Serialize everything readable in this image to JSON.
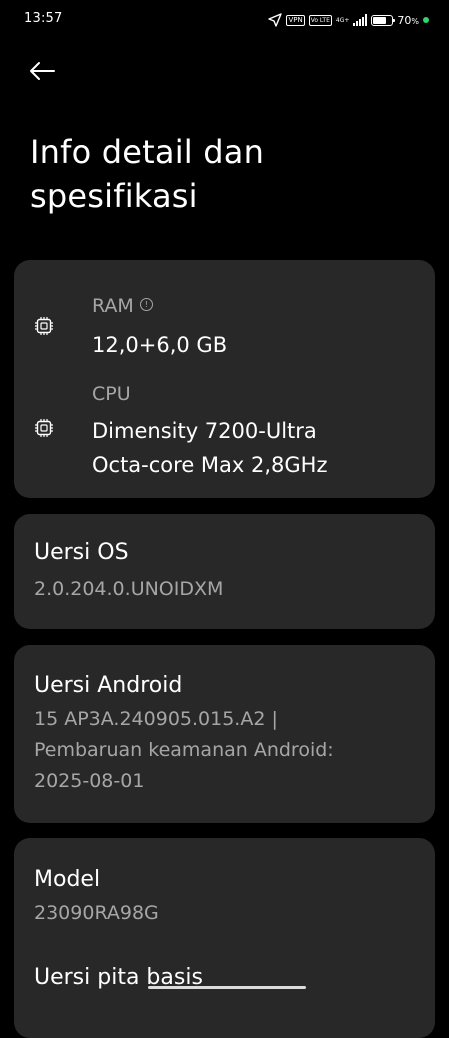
{
  "status_bar": {
    "time": "13:57",
    "vpn_label": "VPN",
    "volte_label": "Vo LTE",
    "network_label": "4G+",
    "battery_percent": "70",
    "battery_unit": "%",
    "battery_level": 0.7,
    "charging_dot_color": "#2fd66b"
  },
  "page": {
    "title_line1": "Info detail dan",
    "title_line2": "spesifikasi"
  },
  "specs": {
    "ram_label": "RAM",
    "ram_value": "12,0+6,0 GB",
    "cpu_label": "CPU",
    "cpu_value_line1": "Dimensity 7200-Ultra",
    "cpu_value_line2": "Octa-core Max 2,8GHz"
  },
  "os": {
    "title": "Uersi OS",
    "value": "2.0.204.0.UNOIDXM"
  },
  "android": {
    "title": "Uersi Android",
    "line1": "15 AP3A.240905.015.A2 |",
    "line2": "Pembaruan keamanan Android:",
    "line3": "2025-08-01"
  },
  "model": {
    "title": "Model",
    "value": "23090RA98G",
    "baseband_title": "Uersi pita basis"
  },
  "colors": {
    "background": "#000000",
    "card": "#282828",
    "secondary_text": "#a6a6a6"
  }
}
